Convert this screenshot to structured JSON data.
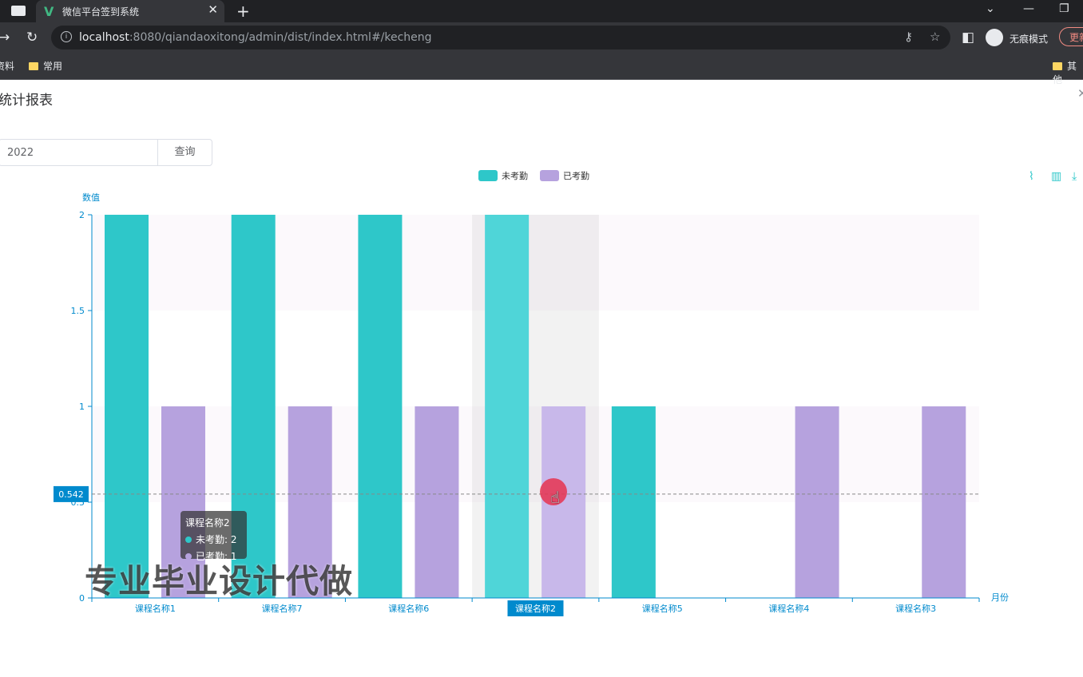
{
  "browser": {
    "tab_title": "微信平台签到系统",
    "url_host": "localhost",
    "url_path": ":8080/qiandaoxitong/admin/dist/index.html#/kecheng",
    "incognito_label": "无痕模式",
    "update_label": "更新",
    "bookmarks": [
      "资料",
      "常用"
    ],
    "other_bookmarks": "其他"
  },
  "page": {
    "title": "统计报表",
    "year_value": "2022",
    "query_button": "查询"
  },
  "chart_data": {
    "type": "bar",
    "title": "",
    "xlabel": "月份",
    "ylabel": "数值",
    "ylim": [
      0,
      2
    ],
    "yticks": [
      "0",
      "0.5",
      "1",
      "1.5",
      "2"
    ],
    "categories": [
      "课程名称1",
      "课程名称7",
      "课程名称6",
      "课程名称2",
      "课程名称5",
      "课程名称4",
      "课程名称3"
    ],
    "series": [
      {
        "name": "未考勤",
        "color": "#2ec7c9",
        "values": [
          2,
          2,
          2,
          2,
          1,
          0,
          0
        ]
      },
      {
        "name": "已考勤",
        "color": "#b6a2de",
        "values": [
          1,
          1,
          1,
          1,
          0,
          1,
          1
        ]
      }
    ],
    "legend": "top-center",
    "highlighted_category": "课程名称2",
    "crosshair_value": "0.542",
    "tooltip": {
      "title": "课程名称2",
      "rows": [
        {
          "label": "未考勤",
          "value": "2",
          "color": "#2ec7c9"
        },
        {
          "label": "已考勤",
          "value": "1",
          "color": "#b6a2de"
        }
      ]
    }
  },
  "overlay": {
    "watermark": "专业毕业设计代做"
  }
}
